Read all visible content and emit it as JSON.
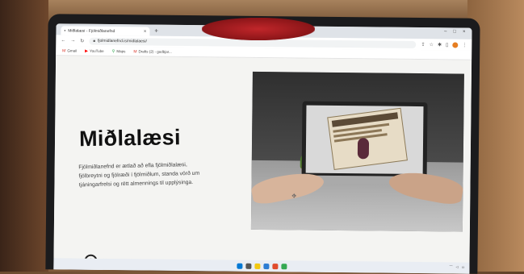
{
  "browser": {
    "tab_title": "Miðlalæsi - Fjölmiðlanefnd",
    "tab_close": "×",
    "new_tab": "+",
    "window_controls": [
      "–",
      "□",
      "×"
    ],
    "url": "fjolmidlanefnd.is/midlalaesi/",
    "bookmarks": [
      {
        "label": "Gmail",
        "icon": "gmail-icon",
        "color": "#d93025"
      },
      {
        "label": "YouTube",
        "icon": "youtube-icon",
        "color": "#ff0000"
      },
      {
        "label": "Maps",
        "icon": "maps-icon",
        "color": "#34a853"
      },
      {
        "label": "Drafts (2) - gudbjar...",
        "icon": "gmail-icon",
        "color": "#d93025"
      }
    ]
  },
  "page": {
    "title": "Miðlalæsi",
    "description": "Fjölmiðlanefnd er ætlað að efla fjölmiðlalæsi, fjölbreytni og fjölræði í fjölmiðlum, standa vörð um tjáningarfrelsi og rétt almennings til upplýsinga."
  },
  "colors": {
    "page_bg": "#f4f4f2",
    "title_color": "#111111",
    "accent_profile": "#e67e22"
  }
}
